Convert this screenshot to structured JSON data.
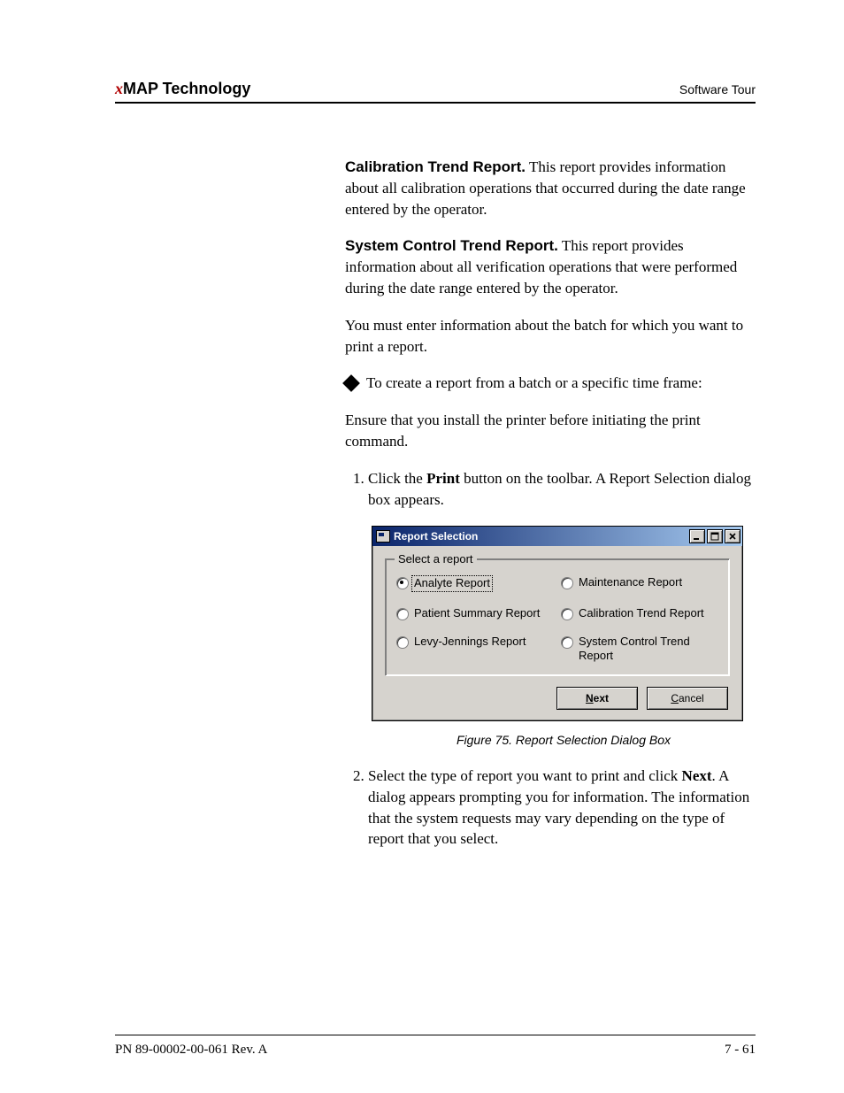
{
  "header": {
    "brand_prefix": "x",
    "brand_rest": "MAP Technology",
    "section": "Software Tour"
  },
  "paragraphs": {
    "p1_runin": "Calibration Trend Report.",
    "p1_rest": " This report provides information about all calibration operations that occurred during the date range entered by the operator.",
    "p2_runin": "System Control Trend Report.",
    "p2_rest": " This report provides information about all verification operations that were performed during the date range entered by the operator.",
    "p3": "You must enter information about the batch for which you want to print a report.",
    "bullet": "To create a report from a batch or a specific time frame:",
    "p4": "Ensure that you install the printer before initiating the print command.",
    "step1_a": "Click the ",
    "step1_b": "Print",
    "step1_c": " button on the toolbar. A Report Selection dialog box appears.",
    "step2_a": "Select the type of report you want to print and click ",
    "step2_b": "Next",
    "step2_c": ". A dialog appears prompting you for information. The information that the system requests may vary depending on the type of report that you select."
  },
  "dialog": {
    "title": "Report Selection",
    "group_legend": "Select a report",
    "options": {
      "analyte": "Analyte Report",
      "maintenance": "Maintenance Report",
      "patient_summary": "Patient Summary Report",
      "calibration_trend": "Calibration Trend Report",
      "levy_jennings": "Levy-Jennings Report",
      "system_control_trend": "System Control Trend Report"
    },
    "buttons": {
      "next_u": "N",
      "next_rest": "ext",
      "cancel_u": "C",
      "cancel_rest": "ancel"
    }
  },
  "figure_caption": "Figure 75.  Report Selection Dialog Box",
  "footer": {
    "left": "PN 89-00002-00-061 Rev. A",
    "right": "7 - 61"
  }
}
